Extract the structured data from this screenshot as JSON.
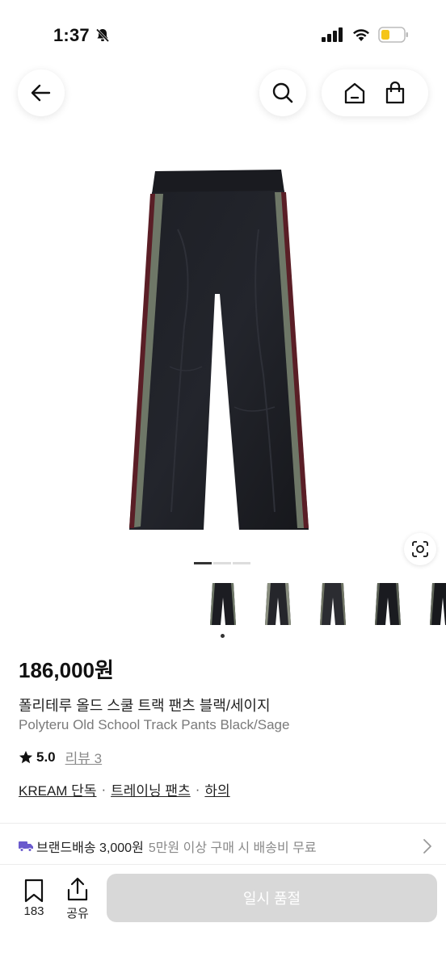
{
  "status_bar": {
    "time": "1:37"
  },
  "product": {
    "price": "186,000원",
    "title_ko": "폴리테루 올드 스쿨 트랙 팬츠 블랙/세이지",
    "title_en": "Polyteru Old School Track Pants Black/Sage",
    "rating": "5.0",
    "review_label": "리뷰 3"
  },
  "tags": [
    {
      "label": "KREAM 단독"
    },
    {
      "label": "트레이닝 팬츠"
    },
    {
      "label": "하의"
    }
  ],
  "separator": "·",
  "shipping": {
    "main": "브랜드배송 3,000원",
    "sub": "5만원 이상 구매 시 배송비 무료"
  },
  "bottom_bar": {
    "bookmark_count": "183",
    "share_label": "공유",
    "soldout_label": "일시 품절"
  },
  "colors": {
    "accent_truck": "#6a5acd",
    "soldout_bg": "#d8d8d8"
  },
  "icons": [
    "back-arrow-icon",
    "search-icon",
    "home-icon",
    "shopping-bag-icon",
    "lens-icon",
    "truck-icon",
    "chevron-right-icon",
    "bookmark-icon",
    "share-icon",
    "star-icon"
  ]
}
